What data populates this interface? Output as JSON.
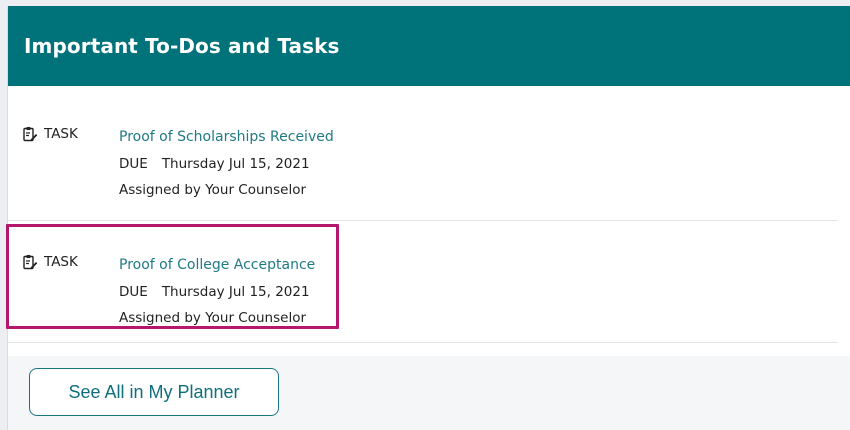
{
  "header": {
    "title": "Important To-Dos and Tasks"
  },
  "tasks": [
    {
      "type": "TASK",
      "title": "Proof of Scholarships Received",
      "due_label": "DUE",
      "due_date": "Thursday Jul 15, 2021",
      "assigned": "Assigned by Your Counselor"
    },
    {
      "type": "TASK",
      "title": "Proof of College Acceptance",
      "due_label": "DUE",
      "due_date": "Thursday Jul 15, 2021",
      "assigned": "Assigned by Your Counselor"
    }
  ],
  "footer": {
    "button_label": "See All in My Planner"
  },
  "colors": {
    "header_bg": "#007279",
    "link": "#1f7a86",
    "highlight": "#b3186a"
  },
  "icons": {
    "task": "clipboard-edit-icon"
  }
}
